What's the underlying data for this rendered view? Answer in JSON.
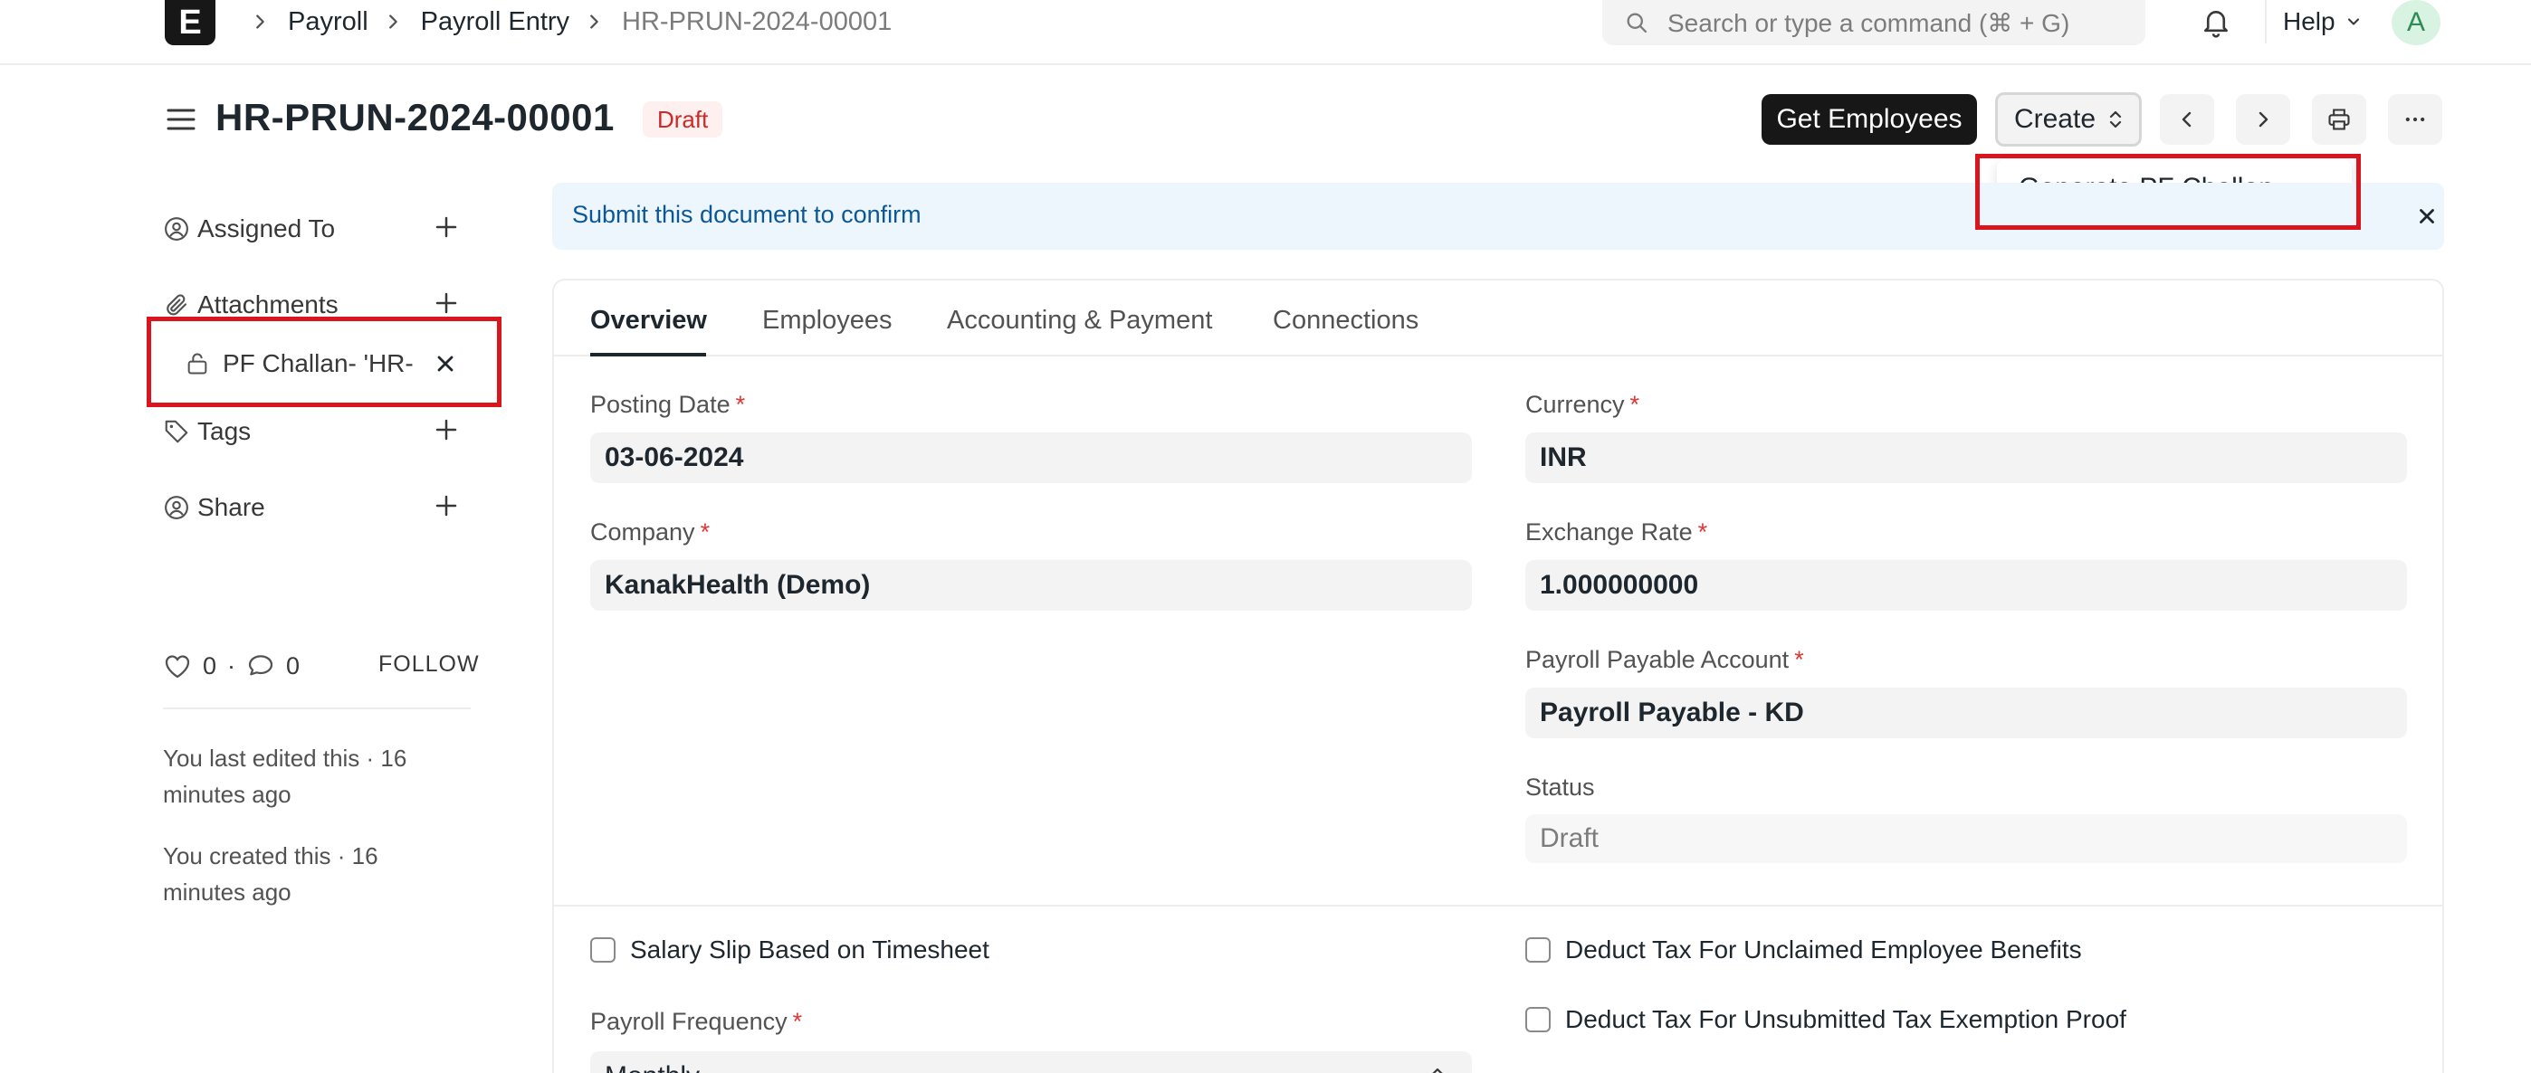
{
  "navbar": {
    "logo_letter": "E",
    "breadcrumbs": [
      "Payroll",
      "Payroll Entry",
      "HR-PRUN-2024-00001"
    ],
    "search_placeholder": "Search or type a command (⌘ + G)",
    "help_label": "Help",
    "avatar_letter": "A"
  },
  "page": {
    "title": "HR-PRUN-2024-00001",
    "status": "Draft",
    "primary_button": "Get Employees",
    "create_button": "Create",
    "create_menu": [
      "Generate PF Challan"
    ]
  },
  "sidebar": {
    "assigned_to": "Assigned To",
    "attachments": "Attachments",
    "attachment_file": "PF Challan- 'HR-",
    "tags": "Tags",
    "share": "Share",
    "likes": "0",
    "comments": "0",
    "dot": "·",
    "follow": "FOLLOW",
    "last_edited": "You last edited this · 16 minutes ago",
    "created": "You created this · 16 minutes ago"
  },
  "alert": {
    "text": "Submit this document to confirm"
  },
  "tabs": [
    "Overview",
    "Employees",
    "Accounting & Payment",
    "Connections"
  ],
  "form": {
    "posting_date_label": "Posting Date",
    "posting_date": "03-06-2024",
    "company_label": "Company",
    "company": "KanakHealth (Demo)",
    "currency_label": "Currency",
    "currency": "INR",
    "exchange_rate_label": "Exchange Rate",
    "exchange_rate": "1.000000000",
    "payable_account_label": "Payroll Payable Account",
    "payable_account": "Payroll Payable - KD",
    "status_label": "Status",
    "status": "Draft",
    "required_mark": "*",
    "salary_slip_timesheet": "Salary Slip Based on Timesheet",
    "payroll_frequency_label": "Payroll Frequency",
    "payroll_frequency": "Monthly",
    "deduct_unclaimed": "Deduct Tax For Unclaimed Employee Benefits",
    "deduct_unsubmitted": "Deduct Tax For Unsubmitted Tax Exemption Proof"
  },
  "colors": {
    "highlight": "#d9161e",
    "draft_text": "#cc2929",
    "alert_bg": "#edf6fd",
    "alert_text": "#0c5896"
  }
}
